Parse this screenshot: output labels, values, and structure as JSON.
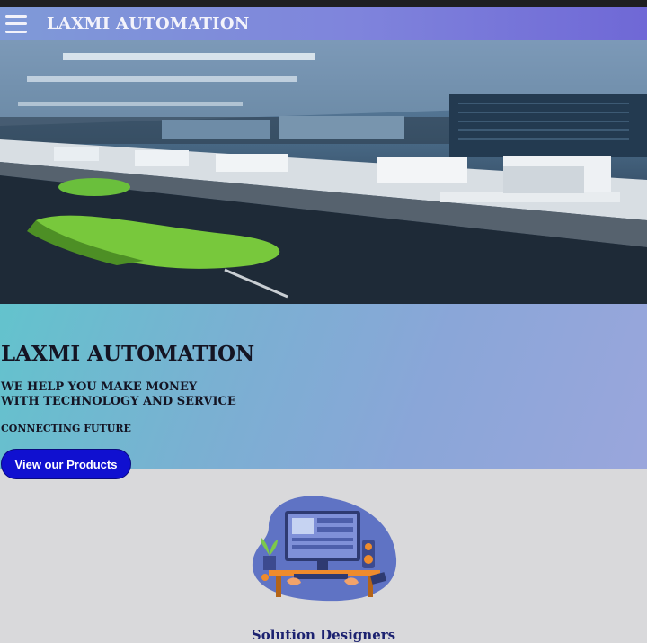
{
  "navbar": {
    "menu_icon": "hamburger-menu-icon",
    "brand": "LAXMI AUTOMATION"
  },
  "hero": {
    "image_description_icon": "office-workspace-image",
    "title": "LAXMI AUTOMATION",
    "tagline_line1": "WE HELP YOU MAKE MONEY",
    "tagline_line2": "WITH TECHNOLOGY AND SERVICE",
    "subtitle": "CONNECTING FUTURE",
    "cta_label": "View our Products"
  },
  "section": {
    "illustration_icon": "computer-desk-illustration",
    "title": "Solution Designers"
  },
  "colors": {
    "navbar_start": "#7f9ad8",
    "navbar_end": "#6f68d6",
    "cta": "#1010d0",
    "section_title": "#1c2270"
  }
}
